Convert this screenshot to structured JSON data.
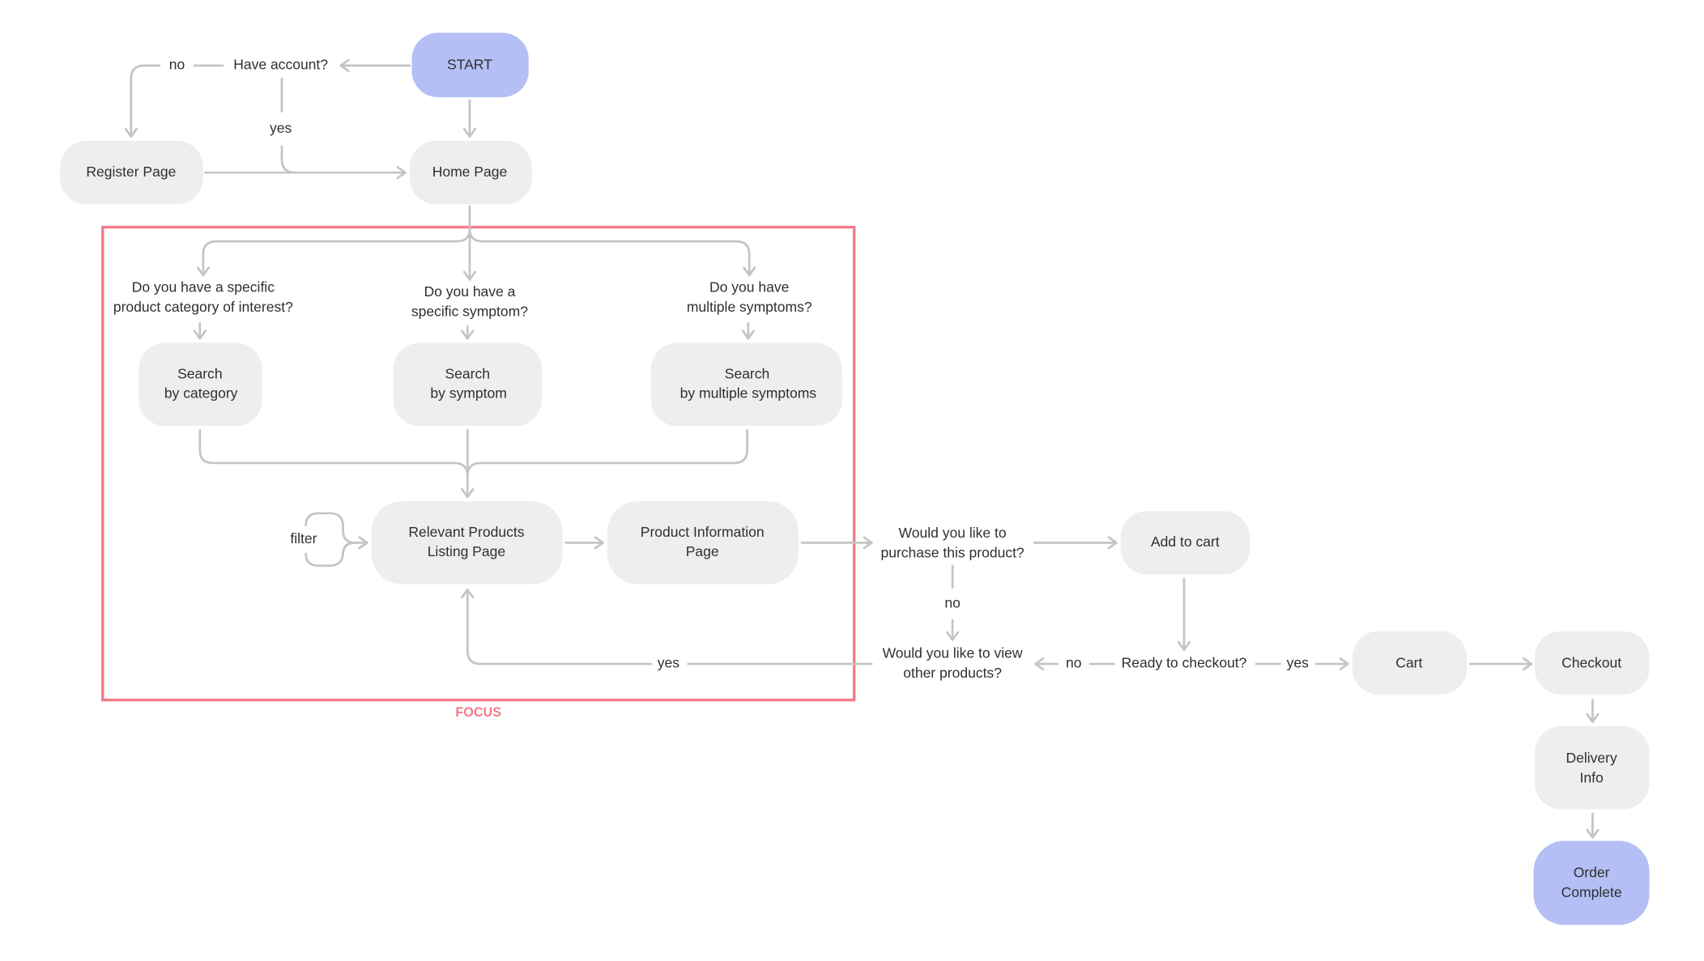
{
  "colors": {
    "terminal": "#b3bff5",
    "node": "#eeeeee",
    "edge": "#c4c4c4",
    "focus": "#f47a8a",
    "text": "#2f2f2f"
  },
  "nodes": {
    "start": [
      "START"
    ],
    "home": [
      "Home Page"
    ],
    "register": [
      "Register Page"
    ],
    "search_category": [
      "Search",
      "by category"
    ],
    "search_symptom": [
      "Search",
      "by symptom"
    ],
    "search_multiple": [
      "Search",
      "by multiple symptoms"
    ],
    "listing": [
      "Relevant Products",
      "Listing Page"
    ],
    "product_info": [
      "Product Information",
      "Page"
    ],
    "add_to_cart": [
      "Add to cart"
    ],
    "cart": [
      "Cart"
    ],
    "checkout": [
      "Checkout"
    ],
    "delivery": [
      "Delivery",
      "Info"
    ],
    "order_complete": [
      "Order",
      "Complete"
    ]
  },
  "decisions": {
    "have_account": [
      "Have account?"
    ],
    "category_q": [
      "Do you have a specific",
      "product category of interest?"
    ],
    "symptom_q": [
      "Do you have a",
      "specific symptom?"
    ],
    "multiple_q": [
      "Do you have",
      "multiple symptoms?"
    ],
    "purchase_q": [
      "Would you like to",
      "purchase this product?"
    ],
    "view_other_q": [
      "Would you like to view",
      "other products?"
    ],
    "ready_q": [
      "Ready to checkout?"
    ]
  },
  "edge_labels": {
    "account_no": "no",
    "account_yes": "yes",
    "filter": "filter",
    "purchase_no": "no",
    "view_other_yes": "yes",
    "ready_no": "no",
    "ready_yes": "yes"
  },
  "focus": {
    "label": "FOCUS"
  }
}
